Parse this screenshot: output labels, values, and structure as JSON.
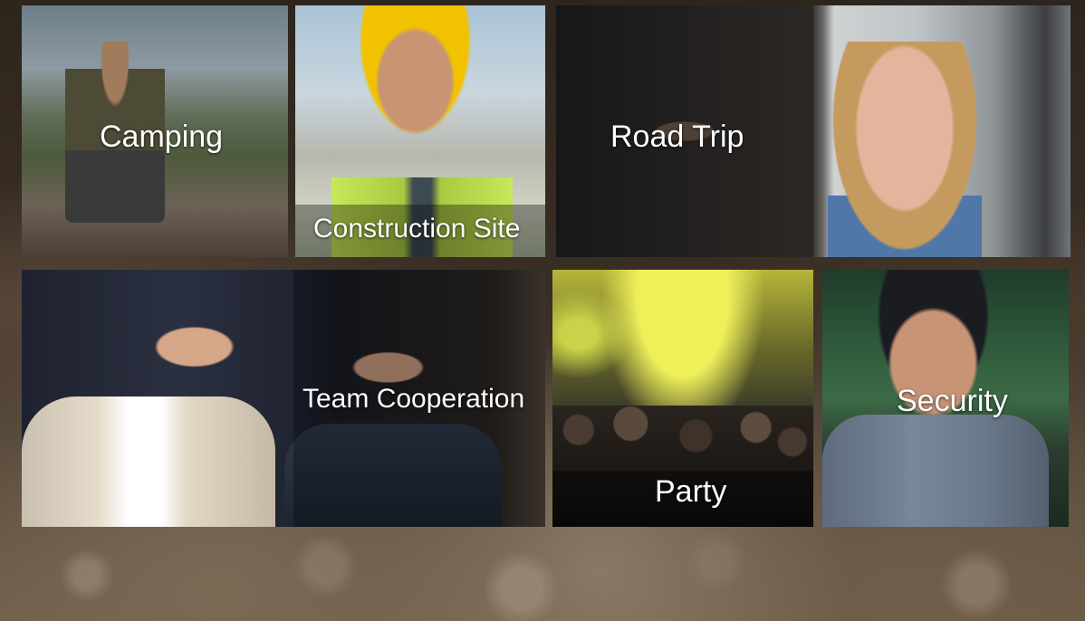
{
  "tiles": {
    "camping": {
      "label": "Camping"
    },
    "construction": {
      "label": "Construction Site"
    },
    "roadtrip": {
      "label": "Road Trip"
    },
    "team": {
      "label": "Team Cooperation"
    },
    "party": {
      "label": "Party"
    },
    "security": {
      "label": "Security"
    }
  }
}
